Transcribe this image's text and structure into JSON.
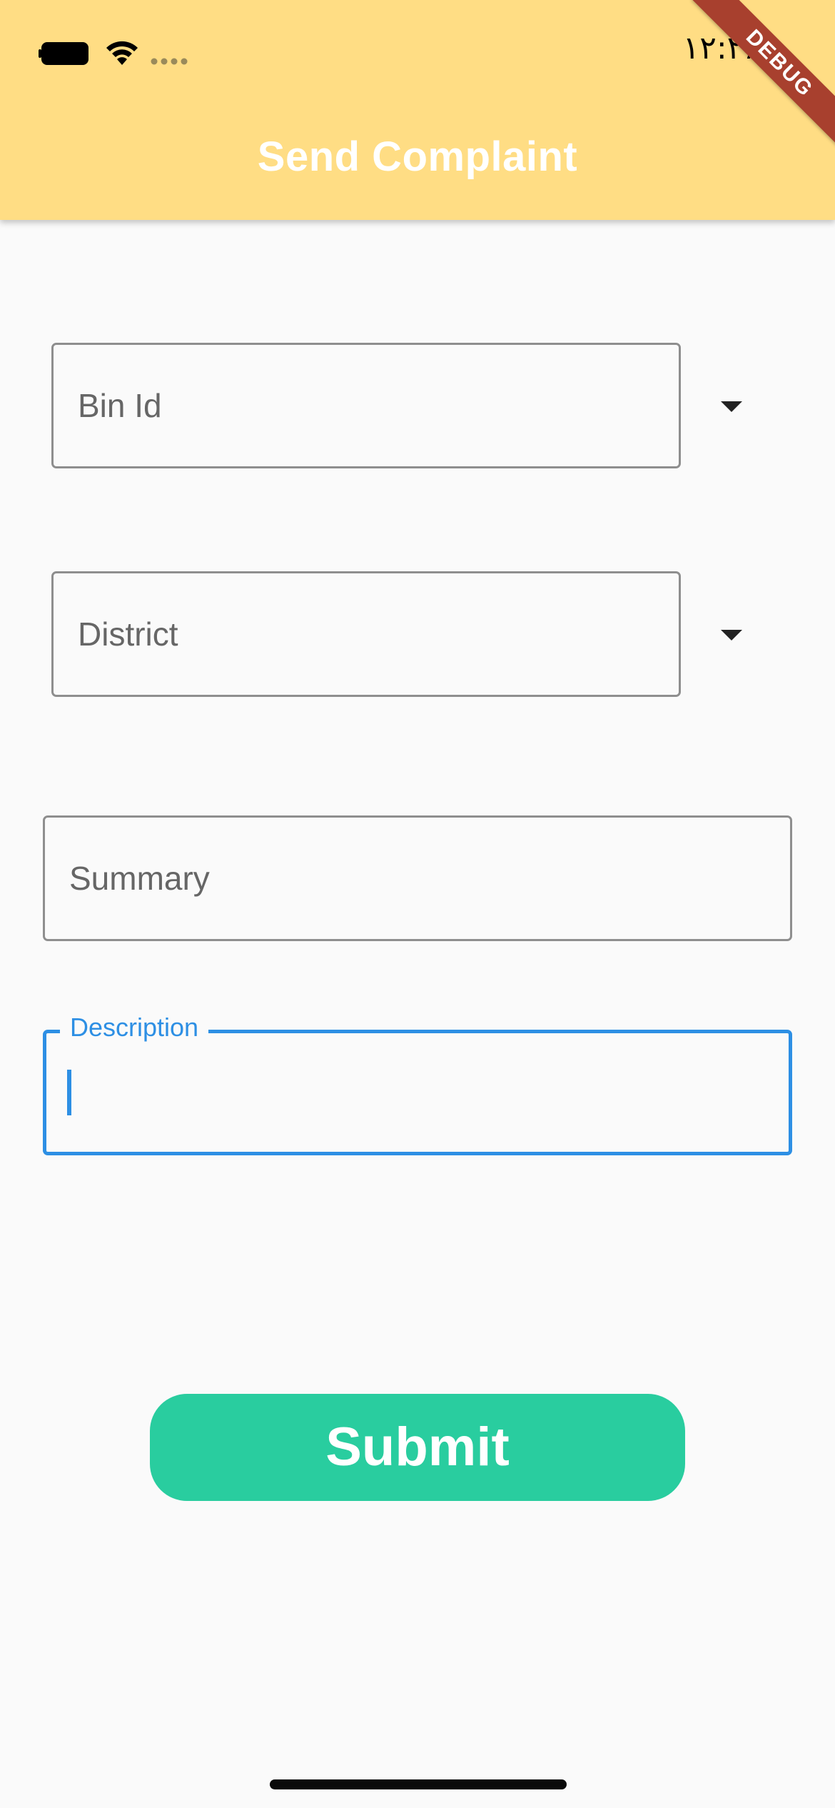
{
  "status_bar": {
    "time": "۱۲:۲۶",
    "battery_icon": "battery-icon",
    "wifi_icon": "wifi-icon",
    "signal_icon": "signal-dots-icon"
  },
  "debug_banner": "DEBUG",
  "app_bar": {
    "title": "Send Complaint",
    "background": "#ffdd84"
  },
  "form": {
    "bin_id": {
      "label": "Bin Id",
      "arrow_icon": "dropdown-arrow-icon"
    },
    "district": {
      "label": "District",
      "arrow_icon": "dropdown-arrow-icon"
    },
    "summary": {
      "placeholder": "Summary",
      "value": ""
    },
    "description": {
      "label": "Description",
      "value": "",
      "focus_color": "#2d8fe4"
    }
  },
  "submit": {
    "label": "Submit",
    "color": "#29cd9f"
  }
}
